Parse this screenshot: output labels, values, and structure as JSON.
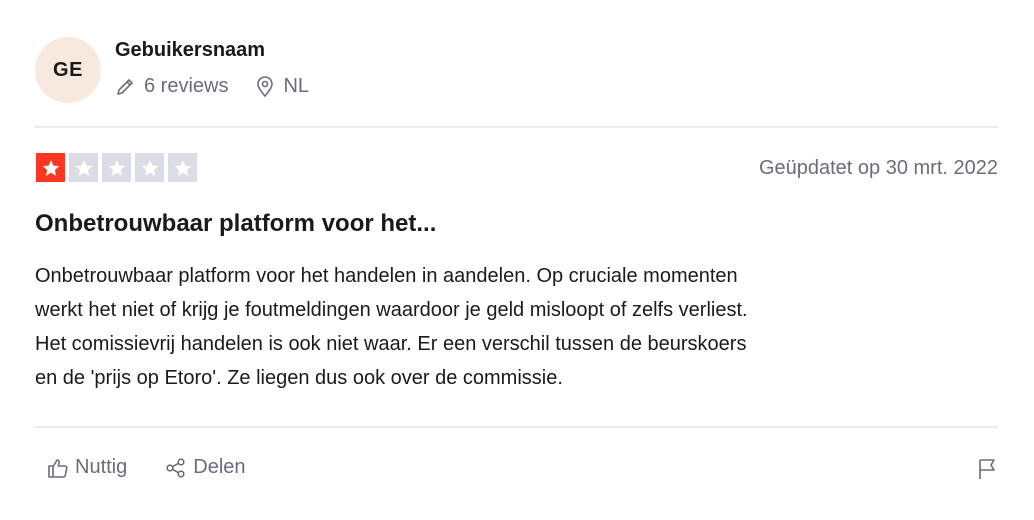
{
  "user": {
    "avatar_initials": "GE",
    "name": "Gebuikersnaam",
    "reviews": "6 reviews",
    "country": "NL"
  },
  "review": {
    "rating": 1,
    "rating_max": 5,
    "star_color": "#ff3722",
    "date": "Geüpdatet op 30 mrt. 2022",
    "title": "Onbetrouwbaar platform voor het...",
    "body_lines": [
      "Onbetrouwbaar platform voor het handelen in aandelen. Op cruciale momenten",
      "werkt het niet of krijg je foutmeldingen waardoor je geld misloopt of zelfs verliest.",
      "Het comissievrij handelen is ook niet waar. Er een verschil tussen de beurskoers",
      "en de 'prijs op Etoro'. Ze liegen dus ook over de commissie."
    ]
  },
  "actions": {
    "useful_label": "Nuttig",
    "useful_icon": "thumbs-up-icon",
    "share_label": "Delen",
    "share_icon": "share-icon",
    "report_icon": "flag-icon"
  }
}
